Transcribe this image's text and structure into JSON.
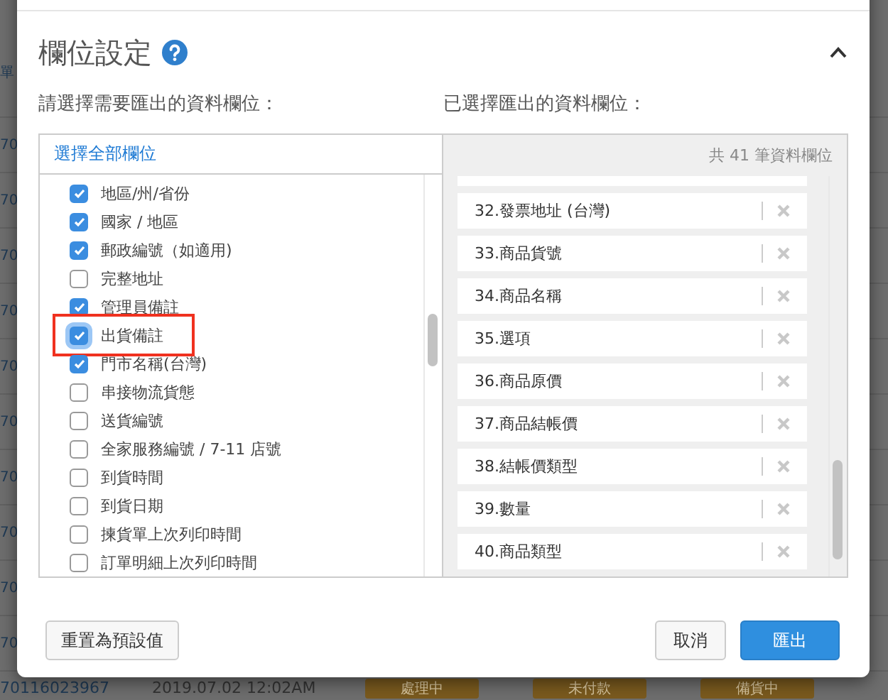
{
  "background_rows": [
    {
      "order": "單"
    },
    {
      "order": "70"
    },
    {
      "order": "70"
    },
    {
      "order": "70"
    },
    {
      "order": "70"
    },
    {
      "order": "70"
    },
    {
      "order": "70"
    },
    {
      "order": "70"
    },
    {
      "order": "70"
    },
    {
      "order": "70"
    },
    {
      "order": "70"
    },
    {
      "order": "70116023967",
      "date": "2019.07.02 12:02AM",
      "badges": [
        "處理中",
        "未付款",
        "備貨中"
      ]
    }
  ],
  "dialog": {
    "title": "欄位設定",
    "expanded": true,
    "available_label": "請選擇需要匯出的資料欄位：",
    "selected_label": "已選擇匯出的資料欄位：",
    "select_all": "選擇全部欄位",
    "count": "共 41 筆資料欄位",
    "available_fields": [
      {
        "label": "地區/州/省份",
        "checked": true,
        "highlighted": false
      },
      {
        "label": "國家 / 地區",
        "checked": true,
        "highlighted": false
      },
      {
        "label": "郵政編號（如適用)",
        "checked": true,
        "highlighted": false
      },
      {
        "label": "完整地址",
        "checked": false,
        "highlighted": false
      },
      {
        "label": "管理員備註",
        "checked": true,
        "highlighted": false
      },
      {
        "label": "出貨備註",
        "checked": true,
        "highlighted": true
      },
      {
        "label": "門市名稱(台灣)",
        "checked": true,
        "highlighted": false
      },
      {
        "label": "串接物流貨態",
        "checked": false,
        "highlighted": false
      },
      {
        "label": "送貨編號",
        "checked": false,
        "highlighted": false
      },
      {
        "label": "全家服務編號 / 7-11 店號",
        "checked": false,
        "highlighted": false
      },
      {
        "label": "到貨時間",
        "checked": false,
        "highlighted": false
      },
      {
        "label": "到貨日期",
        "checked": false,
        "highlighted": false
      },
      {
        "label": "揀貨單上次列印時間",
        "checked": false,
        "highlighted": false
      },
      {
        "label": "訂單明細上次列印時間",
        "checked": false,
        "highlighted": false
      }
    ],
    "selected_fields": [
      "32.發票地址 (台灣)",
      "33.商品貨號",
      "34.商品名稱",
      "35.選項",
      "36.商品原價",
      "37.商品結帳價",
      "38.結帳價類型",
      "39.數量",
      "40.商品類型"
    ],
    "buttons": {
      "reset": "重置為預設值",
      "cancel": "取消",
      "export": "匯出"
    }
  }
}
